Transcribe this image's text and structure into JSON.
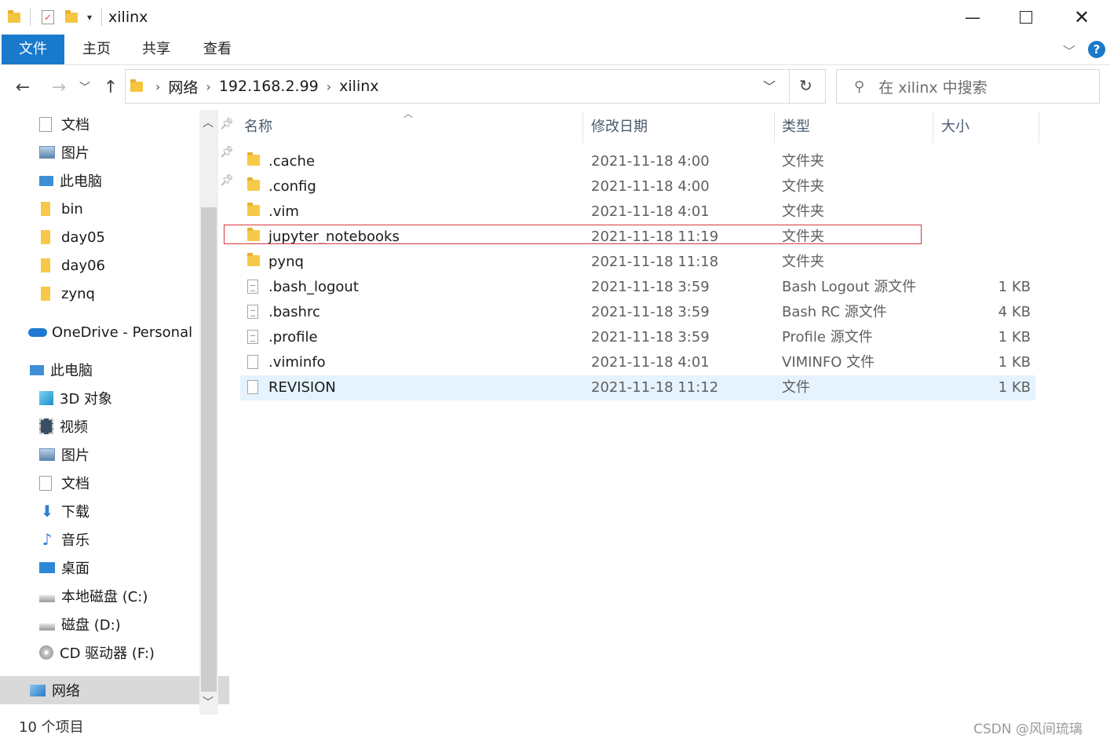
{
  "window": {
    "title": "xilinx",
    "minimize_icon": "minimize-icon",
    "maximize_icon": "maximize-icon",
    "close_icon": "close-icon"
  },
  "ribbon": {
    "tabs": [
      {
        "label": "文件",
        "active": true
      },
      {
        "label": "主页",
        "active": false
      },
      {
        "label": "共享",
        "active": false
      },
      {
        "label": "查看",
        "active": false
      }
    ],
    "accent": "#1979ca"
  },
  "address": {
    "crumbs": [
      "网络",
      "192.168.2.99",
      "xilinx"
    ]
  },
  "search": {
    "placeholder": "在 xilinx 中搜索"
  },
  "nav": {
    "quick_access": [
      {
        "label": "文档",
        "icon": "documents-icon",
        "pinned": true
      },
      {
        "label": "图片",
        "icon": "pictures-icon",
        "pinned": true
      },
      {
        "label": "此电脑",
        "icon": "computer-icon",
        "pinned": true
      },
      {
        "label": "bin",
        "icon": "folder-icon",
        "pinned": false
      },
      {
        "label": "day05",
        "icon": "folder-icon",
        "pinned": false
      },
      {
        "label": "day06",
        "icon": "folder-icon",
        "pinned": false
      },
      {
        "label": "zynq",
        "icon": "folder-icon",
        "pinned": false
      }
    ],
    "onedrive": "OneDrive - Personal",
    "this_pc": "此电脑",
    "pc_items": [
      {
        "label": "3D 对象",
        "icon": "3d-objects-icon"
      },
      {
        "label": "视频",
        "icon": "videos-icon"
      },
      {
        "label": "图片",
        "icon": "pictures-icon"
      },
      {
        "label": "文档",
        "icon": "documents-icon"
      },
      {
        "label": "下载",
        "icon": "downloads-icon"
      },
      {
        "label": "音乐",
        "icon": "music-icon"
      },
      {
        "label": "桌面",
        "icon": "desktop-icon"
      },
      {
        "label": "本地磁盘 (C:)",
        "icon": "drive-icon"
      },
      {
        "label": "磁盘 (D:)",
        "icon": "drive-icon"
      },
      {
        "label": "CD 驱动器 (F:)",
        "icon": "cd-drive-icon"
      }
    ],
    "network": "网络"
  },
  "columns": {
    "name": "名称",
    "date": "修改日期",
    "type": "类型",
    "size": "大小"
  },
  "files": [
    {
      "name": ".cache",
      "date": "2021-11-18 4:00",
      "type": "文件夹",
      "size": "",
      "kind": "folder"
    },
    {
      "name": ".config",
      "date": "2021-11-18 4:00",
      "type": "文件夹",
      "size": "",
      "kind": "folder"
    },
    {
      "name": ".vim",
      "date": "2021-11-18 4:01",
      "type": "文件夹",
      "size": "",
      "kind": "folder"
    },
    {
      "name": "jupyter_notebooks",
      "date": "2021-11-18 11:19",
      "type": "文件夹",
      "size": "",
      "kind": "folder"
    },
    {
      "name": "pynq",
      "date": "2021-11-18 11:18",
      "type": "文件夹",
      "size": "",
      "kind": "folder"
    },
    {
      "name": ".bash_logout",
      "date": "2021-11-18 3:59",
      "type": "Bash Logout 源文件",
      "size": "1 KB",
      "kind": "source"
    },
    {
      "name": ".bashrc",
      "date": "2021-11-18 3:59",
      "type": "Bash RC 源文件",
      "size": "4 KB",
      "kind": "source"
    },
    {
      "name": ".profile",
      "date": "2021-11-18 3:59",
      "type": "Profile 源文件",
      "size": "1 KB",
      "kind": "source"
    },
    {
      "name": ".viminfo",
      "date": "2021-11-18 4:01",
      "type": "VIMINFO 文件",
      "size": "1 KB",
      "kind": "file"
    },
    {
      "name": "REVISION",
      "date": "2021-11-18 11:12",
      "type": "文件",
      "size": "1 KB",
      "kind": "file",
      "selected": true
    }
  ],
  "status": {
    "count": "10 个项目"
  },
  "watermark": "CSDN @风间琉璃"
}
